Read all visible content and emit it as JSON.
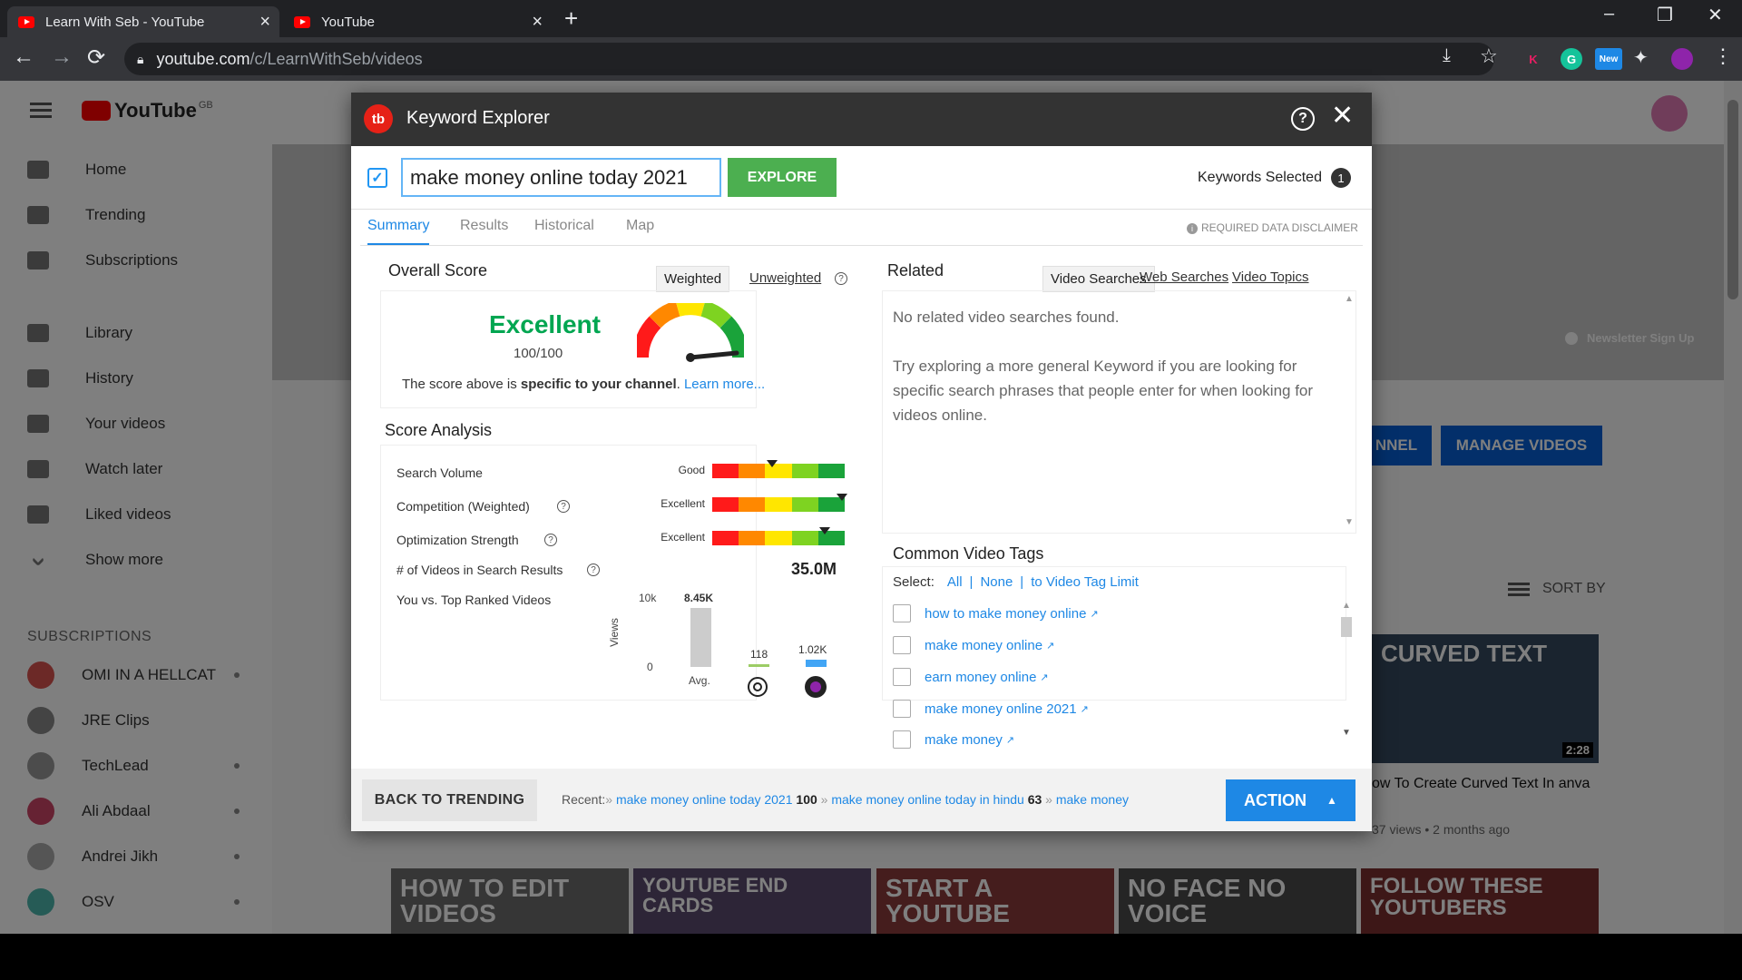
{
  "browser": {
    "tabs": [
      {
        "title": "Learn With Seb - YouTube"
      },
      {
        "title": "YouTube"
      }
    ],
    "url_host": "youtube.com",
    "url_path": "/c/LearnWithSeb/videos",
    "ext_new_label": "New"
  },
  "youtube": {
    "logo_text": "YouTube",
    "logo_region": "GB",
    "nav": [
      "Home",
      "Trending",
      "Subscriptions",
      "Library",
      "History",
      "Your videos",
      "Watch later",
      "Liked videos",
      "Show more"
    ],
    "subscriptions_heading": "SUBSCRIPTIONS",
    "subscriptions": [
      "OMI IN A HELLCAT",
      "JRE Clips",
      "TechLead",
      "Ali Abdaal",
      "Andrei Jikh",
      "OSV"
    ],
    "newsletter": "Newsletter Sign Up",
    "channel_btn": "NNEL",
    "manage_btn": "MANAGE VIDEOS",
    "sort_by": "SORT BY",
    "thumb_text": "CURVED TEXT",
    "thumb_duration": "2:28",
    "video_title": "ow To Create Curved Text In anva",
    "video_meta": "37 views • 2 months ago",
    "bottom_thumbs": [
      "HOW TO EDIT VIDEOS",
      "YOUTUBE END CARDS",
      "START A YOUTUBE",
      "NO FACE NO VOICE",
      "FOLLOW THESE YOUTUBERS"
    ]
  },
  "modal": {
    "logo": "tb",
    "title": "Keyword Explorer",
    "keyword": "make money online today 2021",
    "explore_label": "EXPLORE",
    "keywords_selected_label": "Keywords Selected",
    "keywords_selected_count": "1",
    "tabs": [
      "Summary",
      "Results",
      "Historical",
      "Map"
    ],
    "disclaimer": "REQUIRED DATA DISCLAIMER",
    "overall": {
      "title": "Overall Score",
      "weighted": "Weighted",
      "unweighted": "Unweighted",
      "rating": "Excellent",
      "score": "100/100",
      "note_pre": "The score above is ",
      "note_bold": "specific to your channel",
      "note_post": ". ",
      "learn_more": "Learn more..."
    },
    "analysis": {
      "title": "Score Analysis",
      "metrics": [
        {
          "label": "Search Volume",
          "rating": "Good",
          "level": 0.45
        },
        {
          "label": "Competition (Weighted)",
          "rating": "Excellent",
          "level": 0.98
        },
        {
          "label": "Optimization Strength",
          "rating": "Excellent",
          "level": 0.85
        }
      ],
      "videos_label": "# of Videos in Search Results",
      "videos_count": "35.0M",
      "vs_label": "You vs. Top Ranked Videos",
      "axis_top": "10k",
      "axis_bottom": "0",
      "axis_title": "Views",
      "bars": [
        {
          "value": "8.45K",
          "views": 8450,
          "caption": "Avg."
        },
        {
          "value": "118",
          "views": 118
        },
        {
          "value": "1.02K",
          "views": 1020
        }
      ]
    },
    "related": {
      "title": "Related",
      "tabs": [
        "Video Searches",
        "Web Searches",
        "Video Topics"
      ],
      "empty": "No related video searches found.",
      "hint": "Try exploring a more general Keyword if you are looking for specific search phrases that people enter for when looking for videos online."
    },
    "tags": {
      "title": "Common Video Tags",
      "select_label": "Select:",
      "all": "All",
      "none": "None",
      "limit": "to Video Tag Limit",
      "items": [
        "how to make money online",
        "make money online",
        "earn money online",
        "make money online 2021",
        "make money"
      ]
    },
    "footer": {
      "back": "BACK TO TRENDING",
      "recent_label": "Recent:",
      "recent": [
        {
          "keyword": "make money online today 2021",
          "score": "100"
        },
        {
          "keyword": "make money online today in hindu",
          "score": "63"
        },
        {
          "keyword": "make money",
          "score": ""
        }
      ],
      "action": "ACTION"
    }
  },
  "colors": {
    "accent": "#1e88e5",
    "excellent": "#00a651",
    "explore": "#4caf50",
    "tubebuddy": "#e62117"
  }
}
